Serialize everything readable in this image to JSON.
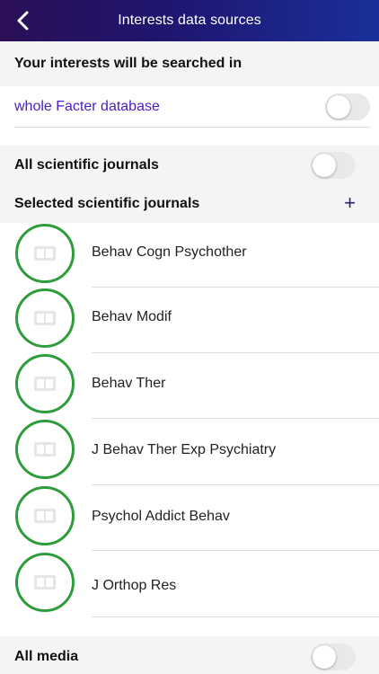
{
  "nav": {
    "title": "Interests data sources",
    "back_icon": "chevron-left-icon"
  },
  "search_scope": {
    "header": "Your interests will be searched in",
    "whole_db_label": "whole Facter database",
    "whole_db_enabled": false
  },
  "journals": {
    "all_label": "All scientific journals",
    "all_enabled": false,
    "selected_header": "Selected scientific journals",
    "add_label": "+",
    "items": [
      {
        "name": "Behav Cogn Psychother",
        "icon": "book-icon"
      },
      {
        "name": "Behav Modif",
        "icon": "book-icon"
      },
      {
        "name": "Behav Ther",
        "icon": "book-icon"
      },
      {
        "name": "J Behav Ther Exp Psychiatry",
        "icon": "book-icon"
      },
      {
        "name": "Psychol Addict Behav",
        "icon": "book-icon"
      },
      {
        "name": "J Orthop Res",
        "icon": "book-icon"
      }
    ]
  },
  "media": {
    "all_label": "All media",
    "all_enabled": false
  },
  "colors": {
    "nav_gradient_start": "#2a0f56",
    "nav_gradient_end": "#1a2f9a",
    "link": "#4b1cc4",
    "journal_ring": "#2e9c3b",
    "section_bg": "#f4f4f4"
  }
}
